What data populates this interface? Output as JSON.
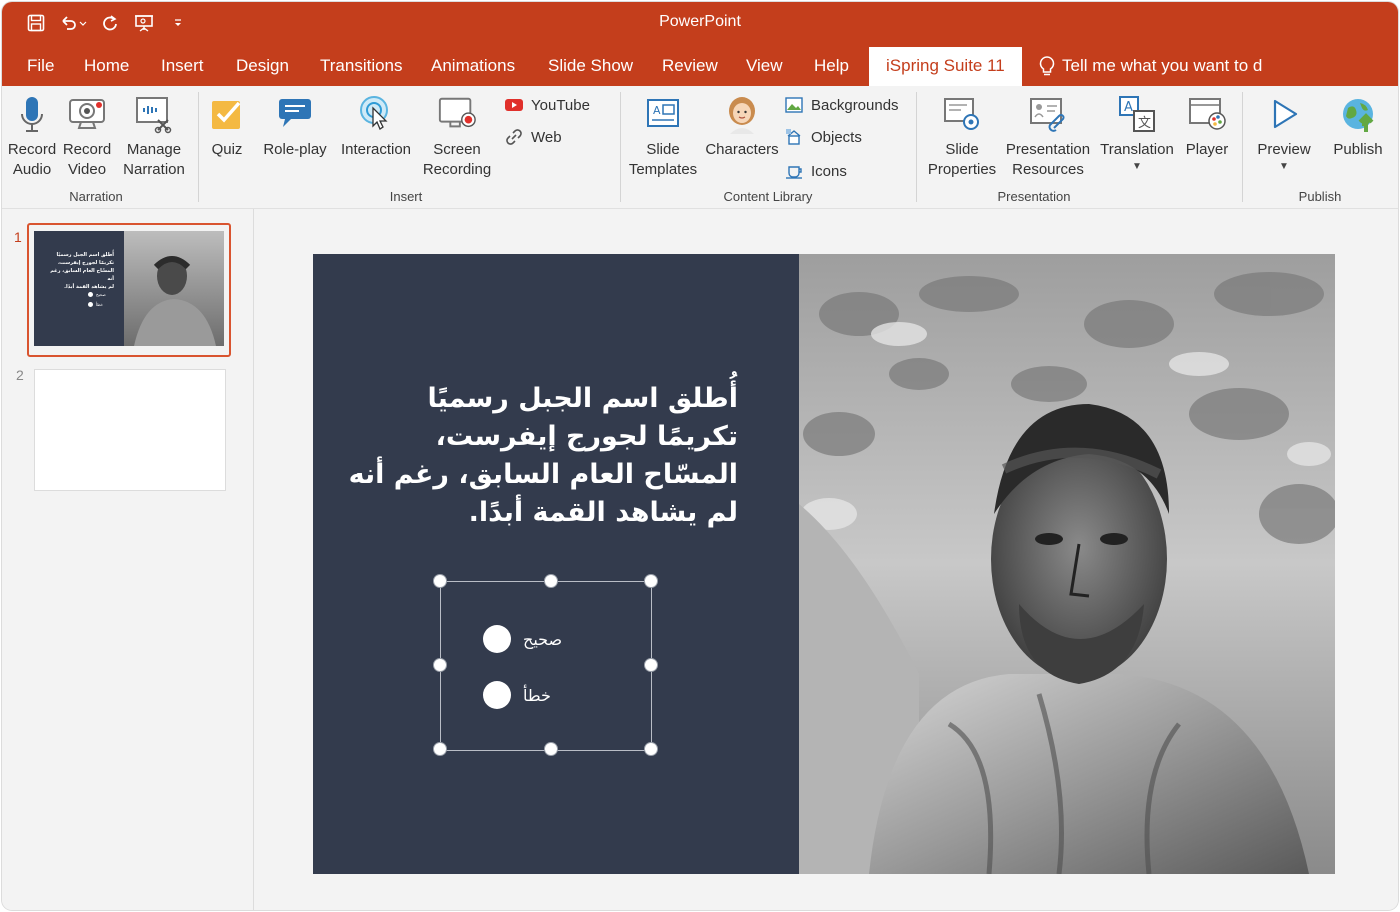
{
  "app": {
    "title": "PowerPoint"
  },
  "tabs": [
    "File",
    "Home",
    "Insert",
    "Design",
    "Transitions",
    "Animations",
    "Slide Show",
    "Review",
    "View",
    "Help"
  ],
  "active_tab": "iSpring Suite 11",
  "tell_me": "Tell me what you want to do",
  "ribbon": {
    "narration": {
      "group_label": "Narration",
      "record_audio": [
        "Record",
        "Audio"
      ],
      "record_video": [
        "Record",
        "Video"
      ],
      "manage_narration": [
        "Manage",
        "Narration"
      ]
    },
    "insert": {
      "group_label": "Insert",
      "quiz": "Quiz",
      "roleplay": "Role-play",
      "interaction": "Interaction",
      "screen_recording": [
        "Screen",
        "Recording"
      ],
      "youtube": "YouTube",
      "web": "Web"
    },
    "content_library": {
      "group_label": "Content Library",
      "slide_templates": [
        "Slide",
        "Templates"
      ],
      "characters": "Characters",
      "backgrounds": "Backgrounds",
      "objects": "Objects",
      "icons": "Icons"
    },
    "presentation": {
      "group_label": "Presentation",
      "slide_properties": [
        "Slide",
        "Properties"
      ],
      "presentation_resources": [
        "Presentation",
        "Resources"
      ],
      "translation": "Translation",
      "player": "Player"
    },
    "publish": {
      "group_label": "Publish",
      "preview": "Preview",
      "publish": "Publish"
    }
  },
  "thumbnails": [
    {
      "number": "1",
      "lines": [
        "أُطلق اسم الجبل رسميًا",
        "تكريمًا لجورج إيفرست،",
        "المسّاح العام السابق، رغم أنه",
        "لم يشاهد القمة أبدًا."
      ],
      "options": [
        "صحيح",
        "خطأ"
      ]
    },
    {
      "number": "2"
    }
  ],
  "slide": {
    "lines": [
      "أُطلق اسم الجبل رسميًا",
      "تكريمًا لجورج إيفرست،",
      "المسّاح العام السابق، رغم أنه",
      "لم يشاهد القمة أبدًا."
    ],
    "options": [
      "صحيح",
      "خطأ"
    ]
  },
  "colors": {
    "accent": "#c43e1c",
    "slide_bg": "#333b4d",
    "ribbon_bg": "#f3f3f3"
  }
}
